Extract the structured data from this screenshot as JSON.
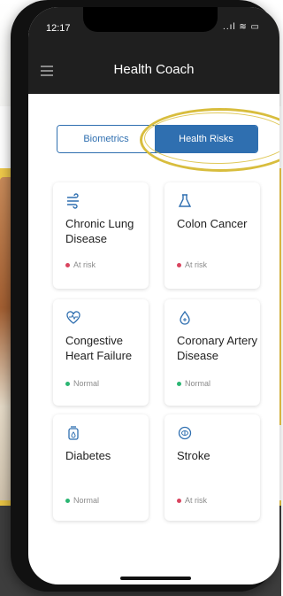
{
  "status": {
    "time": "12:17",
    "icons": "..ıl ≋ ▭"
  },
  "header": {
    "title": "Health Coach"
  },
  "tabs": [
    {
      "label": "Biometrics"
    },
    {
      "label": "Health Risks"
    }
  ],
  "cards": [
    {
      "icon": "lungs-icon",
      "title": "Chronic Lung Disease",
      "status": "At risk",
      "status_color": "#d9455f"
    },
    {
      "icon": "flask-icon",
      "title": "Colon Cancer",
      "status": "At risk",
      "status_color": "#d9455f"
    },
    {
      "icon": "heart-icon",
      "title": "Congestive Heart Failure",
      "status": "Normal",
      "status_color": "#2bb673"
    },
    {
      "icon": "drop-icon",
      "title": "Coronary Artery Disease",
      "status": "Normal",
      "status_color": "#2bb673"
    },
    {
      "icon": "insulin-icon",
      "title": "Diabetes",
      "status": "Normal",
      "status_color": "#2bb673"
    },
    {
      "icon": "brain-icon",
      "title": "Stroke",
      "status": "At risk",
      "status_color": "#d9455f"
    }
  ]
}
